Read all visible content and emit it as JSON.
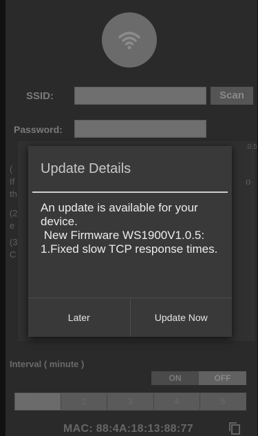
{
  "form": {
    "ssid_label": "SSID:",
    "scan_label": "Scan",
    "password_label": "Password:",
    "version_fragment": ".0.5",
    "bg_lines": [
      "(",
      "If",
      "th",
      "(2",
      "e",
      "(3",
      "C"
    ],
    "bg_right": "o"
  },
  "interval": {
    "label": "Interval ( minute )",
    "on": "ON",
    "off": "OFF",
    "options": [
      "1",
      "2",
      "3",
      "4",
      "5"
    ]
  },
  "mac": {
    "text": "MAC:   88:4A:18:13:88:77"
  },
  "dialog": {
    "title": "Update Details",
    "message": "An update is available for your device.\n New Firmware WS1900V1.0.5:\n1.Fixed slow TCP response times.",
    "later_label": "Later",
    "update_label": "Update Now"
  },
  "icons": {
    "wifi": "wifi-icon",
    "copy": "copy-icon"
  },
  "colors": {
    "background": "#2a2a2a",
    "dialog": "#393939",
    "dialog_text": "#ededed",
    "divider": "#cfcfcf"
  }
}
